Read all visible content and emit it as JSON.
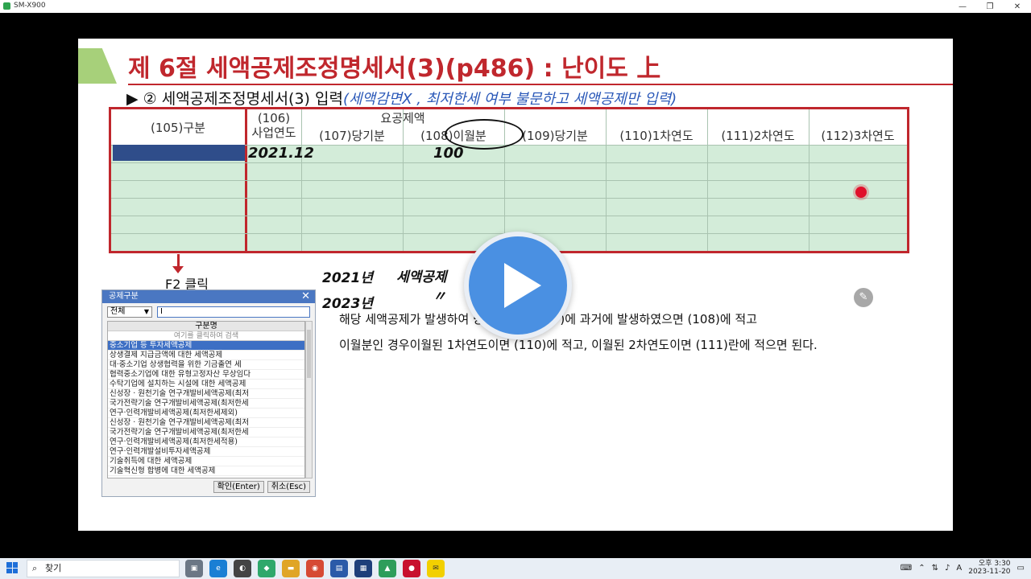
{
  "window": {
    "title": "SM-X900",
    "controls": [
      "—",
      "❐",
      "✕"
    ]
  },
  "slide": {
    "title": "제 6절 세액공제조정명세서(3)(p486) : 난이도 上",
    "subtitle_prefix": "▶ ② 세액공제조정명세서(3) 입력",
    "subtitle_note": "(세액감면X , 최저한세 여부 불문하고 세액공제만 입력)",
    "grid": {
      "group_header": "요공제액",
      "headers": {
        "c105": "(105)구분",
        "c106_a": "(106)",
        "c106_b": "사업연도",
        "c107": "(107)당기분",
        "c108": "(108)이월분",
        "c109": "(109)당기분",
        "c110": "(110)1차연도",
        "c111": "(111)2차연도",
        "c112": "(112)3차연도"
      },
      "hand_year": "2021.12",
      "hand_amount": "100"
    },
    "f2_label": "F2 클릭",
    "dialog": {
      "title": "공제구분",
      "close": "✕",
      "select_value": "전체",
      "input_value": "I",
      "list_header": "구분명",
      "list_filter": "여기를 클릭하여 검색",
      "items": [
        "중소기업 등 투자세액공제",
        "상생결제 지급금액에 대한 세액공제",
        "대·중소기업 상생협력을 위한 기금출연 세",
        "협력중소기업에 대한 유형고정자산 무상임다",
        "수탁기업에 설치하는 시설에 대한 세액공제",
        "신성장 · 원천기술 연구개발비세액공제(최저",
        "국가전략기술 연구개발비세액공제(최저한세",
        "연구·인력개발비세액공제(최저한세제외)",
        "신성장 · 원천기술 연구개발비세액공제(최저",
        "국가전략기술 연구개발비세액공제(최저한세",
        "연구·인력개발비세액공제(최저한세적용)",
        "연구·인력개발설비투자세액공제",
        "기술취득에 대한 세액공제",
        "기술혁신형 합병에 대한 세액공제"
      ],
      "ok_label": "확인(Enter)",
      "cancel_label": "취소(Esc)"
    },
    "hand_notes": {
      "y2021": "2021년",
      "y2023": "2023년",
      "credit": "세액공제",
      "ditto": "〃"
    },
    "body_line1": "해당 세액공제가 발생하여 당기분이면 (107)에 과거에 발생하였으면 (108)에 적고",
    "body_line2": "이월분인 경우이월된 1차연도이면 (110)에 적고, 이월된 2차연도이면 (111)란에 적으면 된다."
  },
  "taskbar": {
    "search_placeholder": "찾기",
    "clock_time": "오후 3:30",
    "clock_date": "2023-11-20",
    "ime": "A"
  },
  "colors": {
    "accent_red": "#c0272d",
    "grid_green": "#d3ecd9",
    "play_blue": "#4a90e2"
  }
}
